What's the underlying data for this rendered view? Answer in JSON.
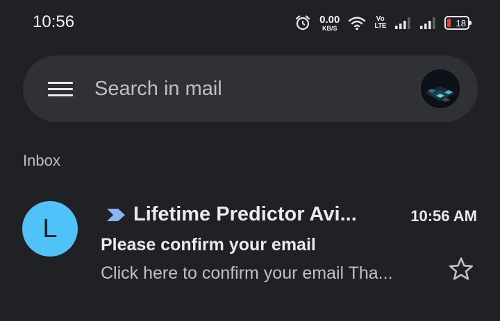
{
  "status_bar": {
    "time": "10:56",
    "net_speed_value": "0.00",
    "net_speed_unit": "KB/S",
    "volte_top": "Vo",
    "volte_bottom": "LTE",
    "battery_level": "18",
    "battery_color": "#ea4335"
  },
  "search": {
    "placeholder": "Search in mail",
    "value": ""
  },
  "section": {
    "label": "Inbox"
  },
  "emails": [
    {
      "avatar_letter": "L",
      "avatar_color": "#4fc3f7",
      "important": true,
      "sender": "Lifetime Predictor Avi...",
      "time": "10:56 AM",
      "subject": "Please confirm your email",
      "snippet": "Click here to confirm your email Tha...",
      "starred": false
    }
  ],
  "icons": {
    "menu": "menu-icon",
    "alarm": "alarm-icon",
    "wifi": "wifi-icon",
    "signal": "signal-icon",
    "battery": "battery-icon",
    "importance": "importance-marker-icon",
    "star": "star-icon"
  }
}
